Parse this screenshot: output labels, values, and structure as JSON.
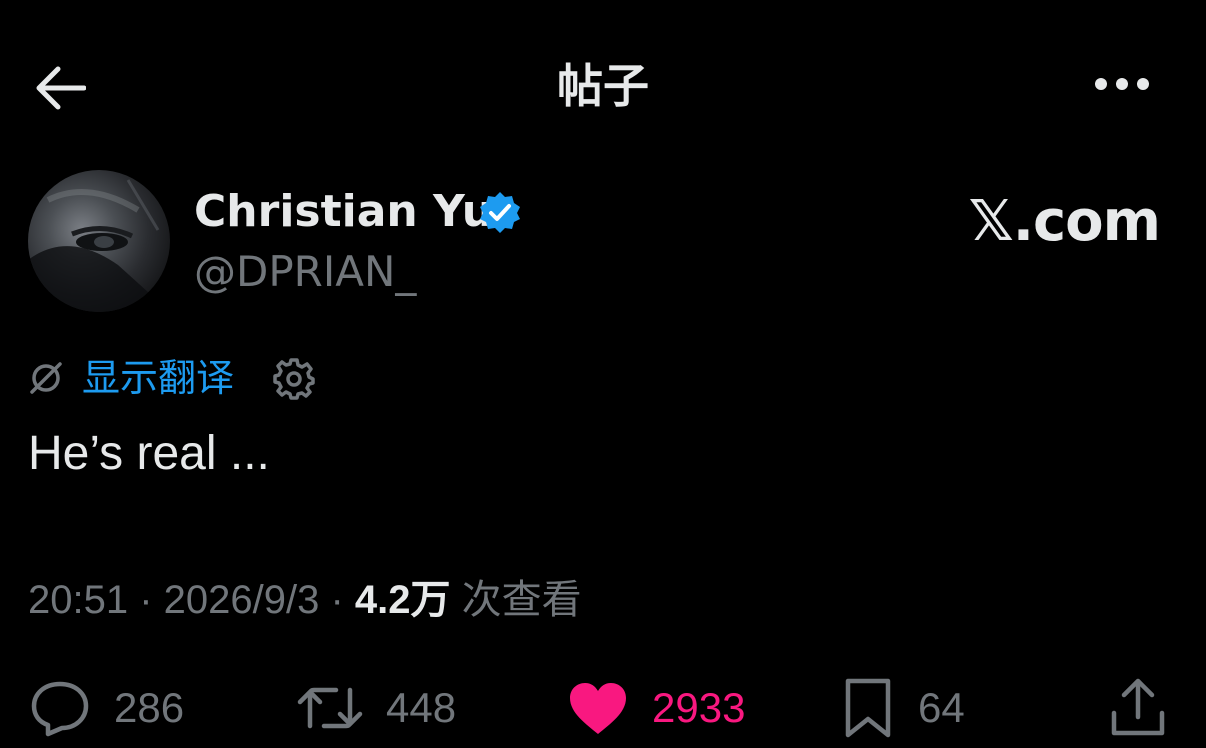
{
  "header": {
    "title": "帖子",
    "back_icon": "arrow-left-icon",
    "more_icon": "more-horizontal-icon"
  },
  "author": {
    "display_name": "Christian Yu",
    "handle": "@DPRIAN_",
    "verified": true,
    "verified_color": "#1d9bf0"
  },
  "watermark": "𝕏.com",
  "translate": {
    "label": "显示翻译",
    "icon": "translate-off-icon",
    "settings_icon": "gear-icon",
    "color": "#1d9bf0"
  },
  "tweet": {
    "text": "He’s real ..."
  },
  "meta": {
    "time": "20:51",
    "separator": " · ",
    "date": "2026/9/3",
    "views_count": "4.2万",
    "views_label": "次查看"
  },
  "actions": {
    "reply_count": "286",
    "retweet_count": "448",
    "like_count": "2933",
    "like_active": true,
    "like_color": "#f91880",
    "bookmark_count": "64"
  }
}
